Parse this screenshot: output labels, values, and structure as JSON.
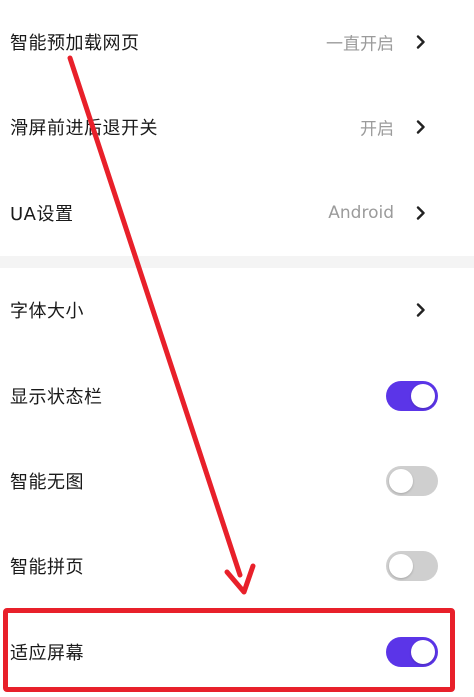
{
  "settings": {
    "rows": [
      {
        "label": "智能预加载网页",
        "value": "一直开启"
      },
      {
        "label": "滑屏前进后退开关",
        "value": "开启"
      },
      {
        "label": "UA设置",
        "value": "Android"
      },
      {
        "label": "字体大小"
      },
      {
        "label": "显示状态栏",
        "toggle": "on"
      },
      {
        "label": "智能无图",
        "toggle": "off"
      },
      {
        "label": "智能拼页",
        "toggle": "off"
      },
      {
        "label": "适应屏幕",
        "toggle": "on"
      }
    ]
  },
  "colors": {
    "toggle_on": "#5b35e8",
    "toggle_off": "#cfcfcf",
    "annotation": "#e8202a"
  },
  "icons": {
    "chevron": "chevron-right-icon"
  }
}
